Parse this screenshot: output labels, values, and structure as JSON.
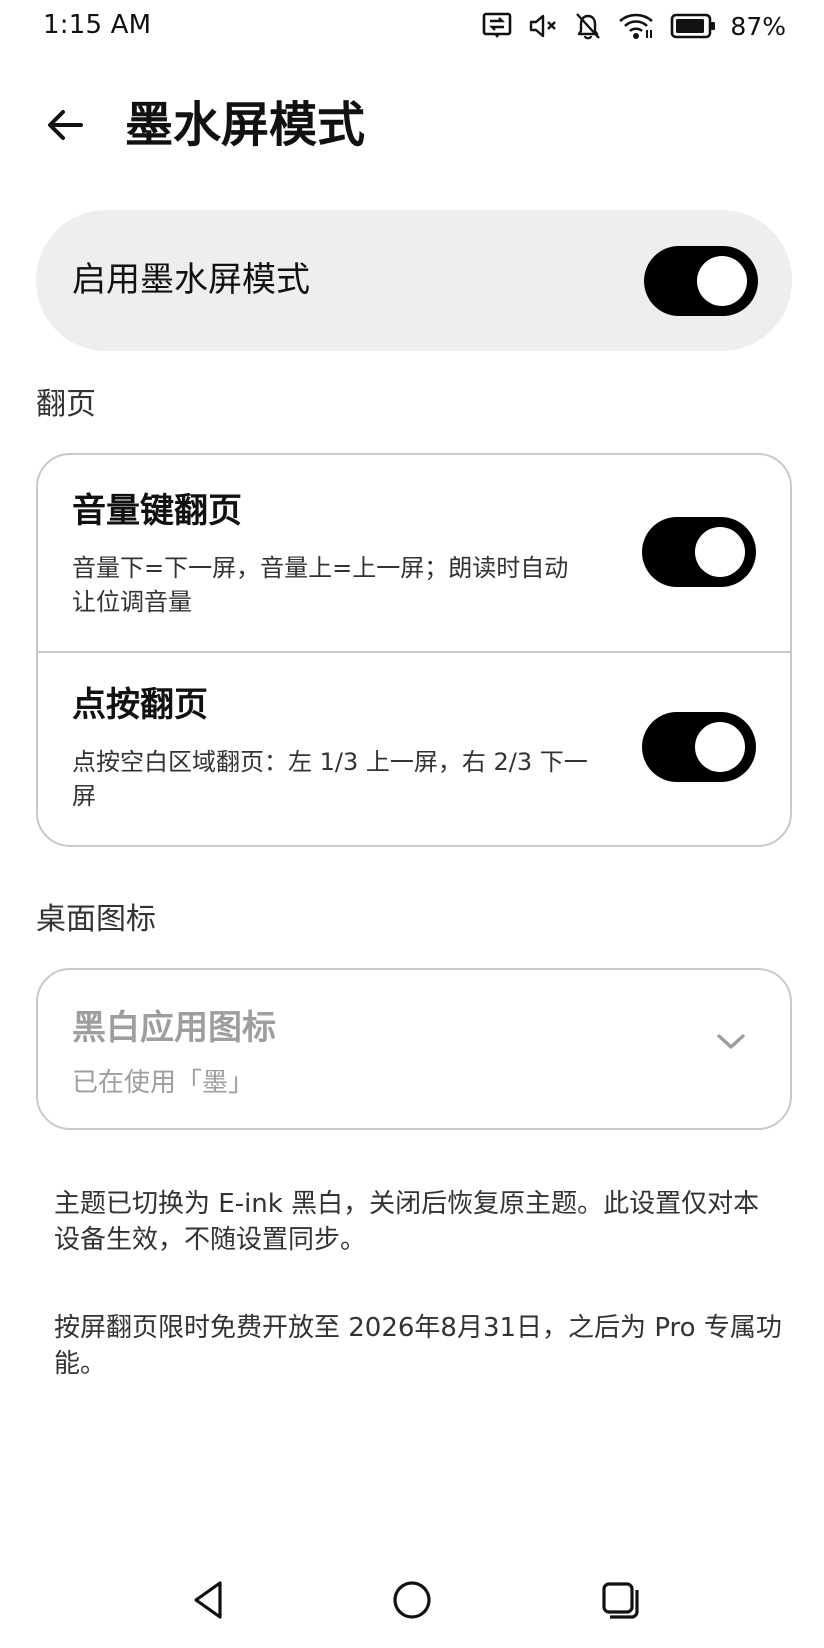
{
  "status_bar": {
    "time": "1:15 AM",
    "icons": [
      "data-saver-icon",
      "volume-mute-icon",
      "notifications-off-icon",
      "wifi-icon",
      "battery-icon"
    ],
    "battery_percent": "87%"
  },
  "app_bar": {
    "back_icon": "arrow-left-icon",
    "title": "墨水屏模式"
  },
  "master_toggle": {
    "label": "启用墨水屏模式",
    "enabled": true
  },
  "page_turn_section": {
    "header": "翻页",
    "items": [
      {
        "title": "音量键翻页",
        "description": "音量下=下一屏，音量上=上一屏；朗读时自动让位调音量",
        "enabled": true
      },
      {
        "title": "点按翻页",
        "description": "点按空白区域翻页：左 1/3 上一屏，右 2/3 下一屏",
        "enabled": true
      }
    ]
  },
  "desktop_icon_section": {
    "header": "桌面图标",
    "select": {
      "title": "黑白应用图标",
      "subtitle": "已在使用「墨」",
      "chevron_icon": "chevron-down-icon",
      "disabled": true
    }
  },
  "notes": {
    "theme_note": "主题已切换为 E-ink 黑白，关闭后恢复原主题。此设置仅对本设备生效，不随设置同步。",
    "pro_note": "按屏翻页限时免费开放至 2026年8月31日，之后为 Pro 专属功能。"
  },
  "nav_bar": {
    "back_icon": "nav-back-triangle-icon",
    "home_icon": "nav-home-circle-icon",
    "recents_icon": "nav-recents-square-icon"
  },
  "colors": {
    "toggle_on": "#000000",
    "card_fill": "#eeeeee",
    "border": "#c9c9c9",
    "disabled_text": "#9e9e9e"
  }
}
